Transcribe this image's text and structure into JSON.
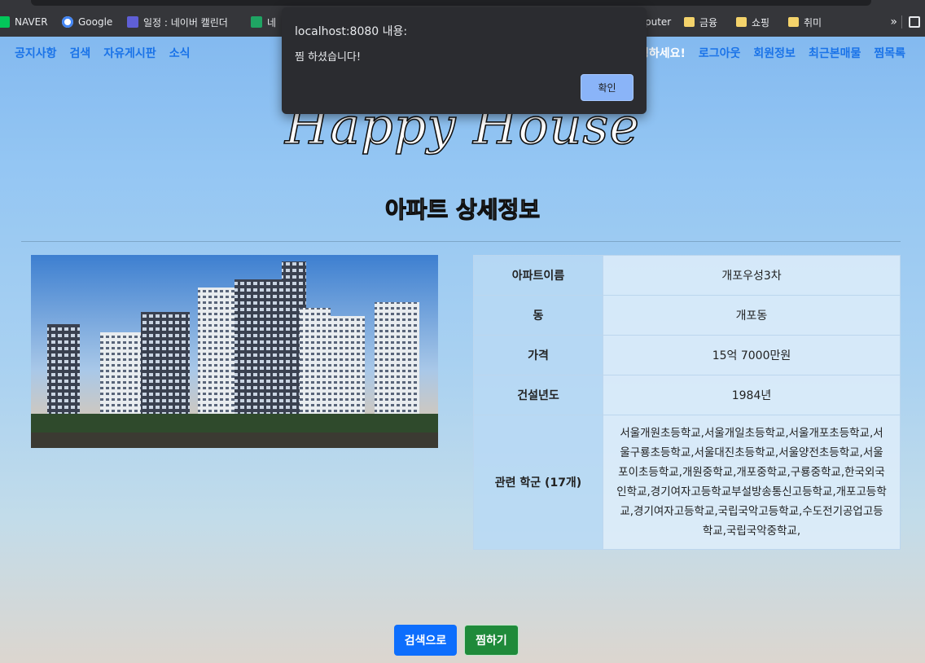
{
  "browser": {
    "bookmarks": [
      {
        "label": "NAVER",
        "icon": "naver-icon"
      },
      {
        "label": "Google",
        "icon": "google-icon"
      },
      {
        "label": "일정 : 네이버 캘린더",
        "icon": "calendar-icon"
      },
      {
        "label": "네",
        "icon": "sheets-icon"
      },
      {
        "label": "puter",
        "icon": "folder-icon"
      },
      {
        "label": "금융",
        "icon": "folder-icon"
      },
      {
        "label": "쇼핑",
        "icon": "folder-icon"
      },
      {
        "label": "취미",
        "icon": "folder-icon"
      }
    ],
    "more_label": "»"
  },
  "nav": {
    "left": [
      "공지사항",
      "검색",
      "자유게시판",
      "소식"
    ],
    "greeting": "녕하세요!",
    "right": [
      "로그아웃",
      "회원정보",
      "최근본매물",
      "찜목록"
    ]
  },
  "header": {
    "logo": "Happy House",
    "heading": "아파트 상세정보"
  },
  "detail": {
    "rows": [
      {
        "label": "아파트이름",
        "value": "개포우성3차"
      },
      {
        "label": "동",
        "value": "개포동"
      },
      {
        "label": "가격",
        "value": "15억 7000만원"
      },
      {
        "label": "건설년도",
        "value": "1984년"
      },
      {
        "label": "관련 학군 (17개)",
        "value": "서울개원초등학교,서울개일초등학교,서울개포초등학교,서울구룡초등학교,서울대진초등학교,서울양전초등학교,서울포이초등학교,개원중학교,개포중학교,구룡중학교,한국외국인학교,경기여자고등학교부설방송통신고등학교,개포고등학교,경기여자고등학교,국립국악고등학교,수도전기공업고등학교,국립국악중학교,"
      }
    ]
  },
  "buttons": {
    "search": "검색으로",
    "like": "찜하기"
  },
  "alert": {
    "origin": "localhost:8080 내용:",
    "message": "찜 하셨습니다!",
    "ok_label": "확인"
  },
  "colors": {
    "nav_link": "#1a73e8",
    "search_button": "#0d6efd",
    "like_button": "#1f8a3a",
    "dialog_bg": "#2b2c30",
    "dialog_ok": "#8ab4f8"
  }
}
